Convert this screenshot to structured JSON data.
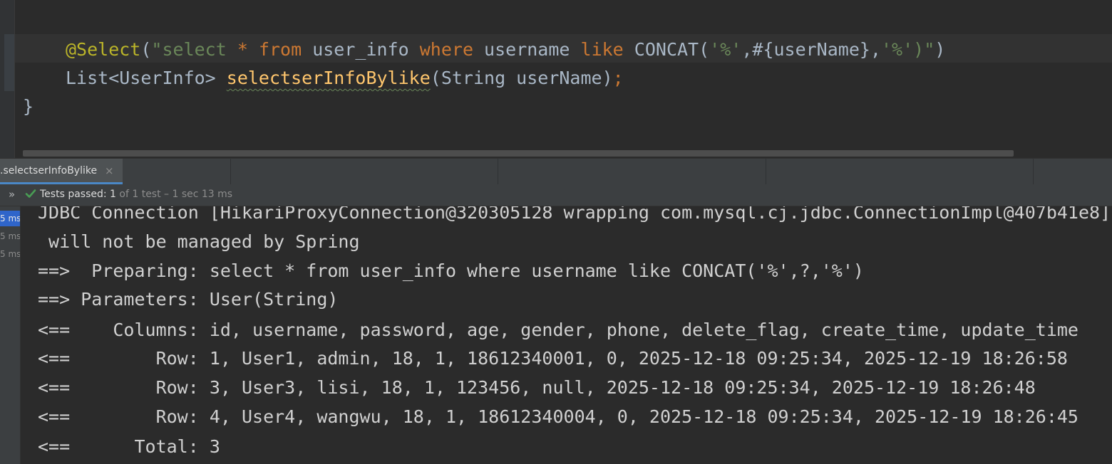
{
  "editor": {
    "line1": {
      "annotation": "@Select",
      "paren_open": "(",
      "str_a": "\"select ",
      "kw_a": "* from",
      "str_b": " user_info ",
      "kw_b": "where",
      "str_c": " username ",
      "kw_c": "like",
      "str_d": " CONCAT(",
      "sq1": "'%'",
      "str_e": ",#{userName},",
      "sq2": "'%'",
      "str_f": ")\"",
      "paren_close": ")"
    },
    "line2": {
      "return_type": "List<UserInfo> ",
      "method_name": "selectserInfoBylike",
      "params": "(String userName)",
      "semicolon": ";"
    },
    "line3": "}"
  },
  "run_window": {
    "tab_label": ".selectserInfoBylike",
    "tab_close": "×",
    "expand": "»",
    "status_passed": "Tests passed: 1",
    "status_meta": " of 1 test – 1 sec 13 ms",
    "tree_times": [
      "5 ms",
      "5 ms",
      "5 ms"
    ]
  },
  "console": {
    "lines": [
      "JDBC Connection [HikariProxyConnection@320305128 wrapping com.mysql.cj.jdbc.ConnectionImpl@407b41e8]",
      " will not be managed by Spring",
      "==>  Preparing: select * from user_info where username like CONCAT('%',?,'%')",
      "==> Parameters: User(String)",
      "<==    Columns: id, username, password, age, gender, phone, delete_flag, create_time, update_time",
      "<==        Row: 1, User1, admin, 18, 1, 18612340001, 0, 2025-12-18 09:25:34, 2025-12-19 18:26:58",
      "<==        Row: 3, User3, lisi, 18, 1, 123456, null, 2025-12-18 09:25:34, 2025-12-19 18:26:48",
      "<==        Row: 4, User4, wangwu, 18, 1, 18612340004, 0, 2025-12-18 09:25:34, 2025-12-19 18:26:45",
      "<==      Total: 3"
    ]
  },
  "colors": {
    "background": "#2b2b2b",
    "annotation": "#bbb529",
    "keyword": "#cc7832",
    "string": "#6a8759",
    "method": "#ffc66d",
    "success": "#499c54",
    "selection": "#2f65ca"
  }
}
